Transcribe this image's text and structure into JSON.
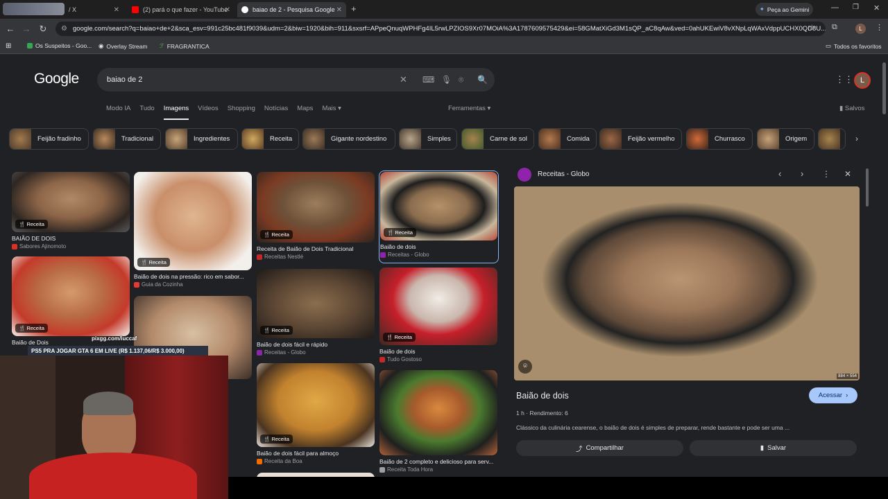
{
  "browser": {
    "tabs": [
      {
        "label": "/ X"
      },
      {
        "label": "(2) pará o que fazer - YouTube"
      },
      {
        "label": "baiao de 2 - Pesquisa Google"
      }
    ],
    "gemini_button": "Peça ao Gemini",
    "url": "google.com/search?q=baiao+de+2&sca_esv=991c25bc481f9039&udm=2&biw=1920&bih=911&sxsrf=APpeQnuqWPHFg4IL5rwLPZIOS9Xr07MOiA%3A1787609575429&ei=58GMatXiGd3M1sQP_aC8qAw&ved=0ahUKEwiV8vXNpLqWAxVdppUCHX0QD8U...",
    "avatar_letter": "L",
    "bookmarks": [
      "Os Suspeitos - Goo...",
      "Overlay Stream",
      "FRAGRANTICA"
    ],
    "all_favorites": "Todos os favoritos"
  },
  "google": {
    "logo": "Google",
    "query": "baiao de 2",
    "avatar_letter": "L",
    "nav": [
      "Modo IA",
      "Tudo",
      "Imagens",
      "Vídeos",
      "Shopping",
      "Notícias",
      "Maps",
      "Mais"
    ],
    "tools": "Ferramentas",
    "saved": "Salvos",
    "chips": [
      "Feijão fradinho",
      "Tradicional",
      "Ingredientes",
      "Receita",
      "Gigante nordestino",
      "Simples",
      "Carne de sol",
      "Comida",
      "Feijão vermelho",
      "Churrasco",
      "Origem",
      "M"
    ]
  },
  "results": {
    "badge": "Receita",
    "cards": [
      {
        "title": "BAIÃO DE DOIS",
        "source": "Sabores Ajinomoto",
        "favcolor": "#d93025"
      },
      {
        "title": "Baião de dois na pressão: rico em sabor...",
        "source": "Guia da Cozinha",
        "favcolor": "#e53935"
      },
      {
        "title": "Receita de Baião de Dois Tradicional",
        "source": "Receitas Nestlé",
        "favcolor": "#c62828"
      },
      {
        "title": "Baião de dois",
        "source": "Receitas - Globo",
        "favcolor": "#8e24aa"
      },
      {
        "title": "Baião de Dois",
        "source": "",
        "favcolor": "#f9ab00"
      },
      {
        "title": "Baião de dois fácil e rápido",
        "source": "Receitas - Globo",
        "favcolor": "#8e24aa"
      },
      {
        "title": "Baião de dois",
        "source": "Tudo Gostoso",
        "favcolor": "#c62828"
      },
      {
        "title": "Baião de dois fácil para almoço",
        "source": "Receita da Boa",
        "favcolor": "#ef6c00"
      },
      {
        "title": "Baião de 2 completo e delicioso para serv...",
        "source": "Receita Toda Hora",
        "favcolor": "#9e9e9e"
      }
    ]
  },
  "panel": {
    "source": "Receitas - Globo",
    "size": "884 × 554",
    "title": "Baião de dois",
    "time": "1 h",
    "yield": "Rendimento: 6",
    "description": "Clássico da culinária cearense, o baião de dois é simples de preparar, rende bastante e pode ser uma ...",
    "visit": "Acessar",
    "share": "Compartilhar",
    "save": "Salvar"
  },
  "stream": {
    "pix": "pixgg.com/luccaf",
    "ticker": "PS5 PRA JOGAR GTA 6 EM LIVE (R$ 1.137,06/R$ 3.000,00)"
  },
  "colors": {
    "accent": "#a8c7fa",
    "selected": "#8ab4f8",
    "bg": "#202124"
  }
}
